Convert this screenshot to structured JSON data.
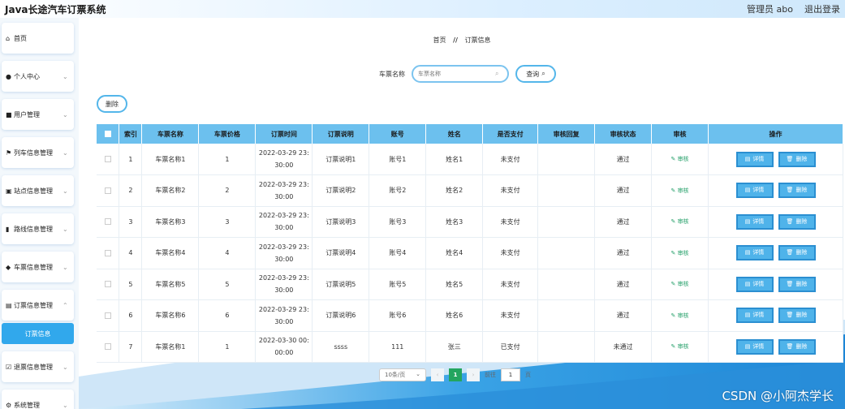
{
  "app": {
    "title": "Java长途汽车订票系统",
    "admin_label": "管理员 abo",
    "logout_label": "退出登录"
  },
  "sidebar": {
    "items": [
      {
        "label": "首页",
        "icon": "home-icon"
      },
      {
        "label": "个人中心",
        "icon": "user-icon"
      },
      {
        "label": "用户管理",
        "icon": "users-icon"
      },
      {
        "label": "列车信息管理",
        "icon": "flag-icon"
      },
      {
        "label": "站点信息管理",
        "icon": "station-icon"
      },
      {
        "label": "路线信息管理",
        "icon": "chart-icon"
      },
      {
        "label": "车票信息管理",
        "icon": "location-icon"
      },
      {
        "label": "订票信息管理",
        "icon": "clipboard-icon"
      },
      {
        "label": "退票信息管理",
        "icon": "checkbox-icon"
      },
      {
        "label": "系统管理",
        "icon": "settings-icon"
      }
    ],
    "active_sub": "订票信息"
  },
  "breadcrumb": {
    "home": "首页",
    "sep": "//",
    "current": "订票信息"
  },
  "search": {
    "label": "车票名称",
    "placeholder": "车票名称",
    "button": "查询"
  },
  "toolbar": {
    "delete_label": "删除"
  },
  "table": {
    "headers": [
      "索引",
      "车票名称",
      "车票价格",
      "订票时间",
      "订票说明",
      "账号",
      "姓名",
      "是否支付",
      "审核回复",
      "审核状态",
      "审核",
      "操作"
    ],
    "audit_label": "审核",
    "detail_label": "详情",
    "delete_label": "删除",
    "rows": [
      {
        "idx": "1",
        "name": "车票名称1",
        "price": "1",
        "time1": "2022-03-29 23:",
        "time2": "30:00",
        "note": "订票说明1",
        "account": "账号1",
        "person": "姓名1",
        "paid": "未支付",
        "reply": "",
        "status": "通过"
      },
      {
        "idx": "2",
        "name": "车票名称2",
        "price": "2",
        "time1": "2022-03-29 23:",
        "time2": "30:00",
        "note": "订票说明2",
        "account": "账号2",
        "person": "姓名2",
        "paid": "未支付",
        "reply": "",
        "status": "通过"
      },
      {
        "idx": "3",
        "name": "车票名称3",
        "price": "3",
        "time1": "2022-03-29 23:",
        "time2": "30:00",
        "note": "订票说明3",
        "account": "账号3",
        "person": "姓名3",
        "paid": "未支付",
        "reply": "",
        "status": "通过"
      },
      {
        "idx": "4",
        "name": "车票名称4",
        "price": "4",
        "time1": "2022-03-29 23:",
        "time2": "30:00",
        "note": "订票说明4",
        "account": "账号4",
        "person": "姓名4",
        "paid": "未支付",
        "reply": "",
        "status": "通过"
      },
      {
        "idx": "5",
        "name": "车票名称5",
        "price": "5",
        "time1": "2022-03-29 23:",
        "time2": "30:00",
        "note": "订票说明5",
        "account": "账号5",
        "person": "姓名5",
        "paid": "未支付",
        "reply": "",
        "status": "通过"
      },
      {
        "idx": "6",
        "name": "车票名称6",
        "price": "6",
        "time1": "2022-03-29 23:",
        "time2": "30:00",
        "note": "订票说明6",
        "account": "账号6",
        "person": "姓名6",
        "paid": "未支付",
        "reply": "",
        "status": "通过"
      },
      {
        "idx": "7",
        "name": "车票名称1",
        "price": "1",
        "time1": "2022-03-30 00:",
        "time2": "00:00",
        "note": "ssss",
        "account": "111",
        "person": "张三",
        "paid": "已支付",
        "reply": "",
        "status": "未通过"
      }
    ]
  },
  "pager": {
    "page_size": "10条/页",
    "current_page": "1",
    "goto_label": "前往",
    "goto_value": "1",
    "page_unit": "页"
  },
  "watermark": "CSDN @小阿杰学长",
  "colors": {
    "accent": "#4fb3ea",
    "header": "#6cc0ee",
    "active_page": "#23a55f",
    "audit": "#25a06a"
  }
}
